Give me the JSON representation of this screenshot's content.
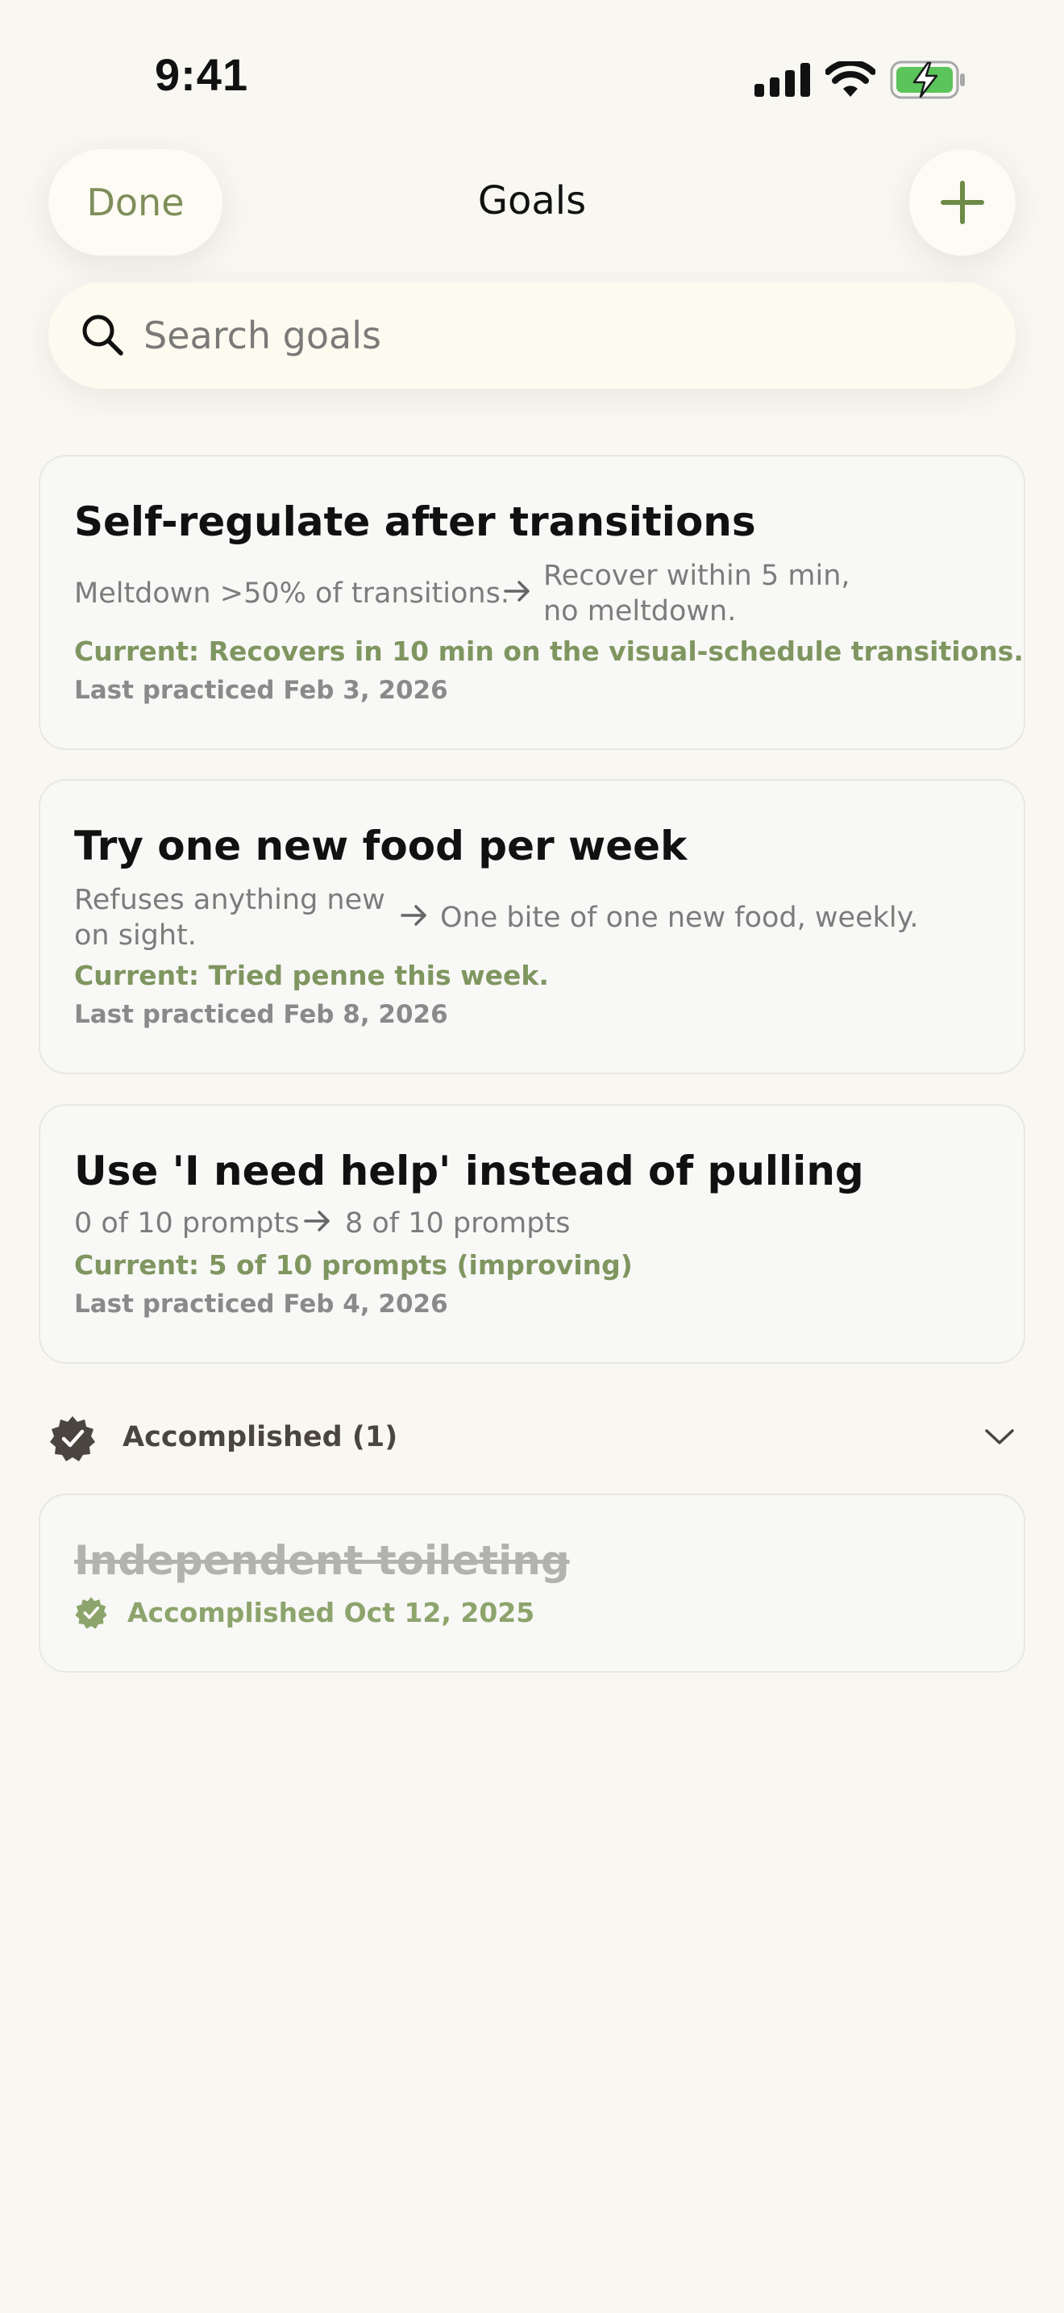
{
  "status_bar": {
    "time": "9:41",
    "icons": [
      "cellular-signal-icon",
      "wifi-icon",
      "battery-charging-icon"
    ]
  },
  "nav": {
    "done_label": "Done",
    "title": "Goals",
    "add_icon": "plus-icon"
  },
  "search": {
    "placeholder": "Search goals",
    "value": "",
    "icon": "search-icon"
  },
  "goals": [
    {
      "title": "Self-regulate after transitions",
      "baseline": "Meltdown >50% of transitions.",
      "target_line1": "Recover within 5 min,",
      "target_line2": "no meltdown.",
      "current": "Current: Recovers in 10 min on the visual-schedule transitions.",
      "last_practiced": "Last practiced Feb 3, 2026"
    },
    {
      "title": "Try one new food per week",
      "baseline_line1": "Refuses anything new",
      "baseline_line2": "on sight.",
      "target": "One bite of one new food, weekly.",
      "current": "Current: Tried penne this week.",
      "last_practiced": "Last practiced Feb 8, 2026"
    },
    {
      "title": "Use 'I need help' instead of pulling",
      "baseline": "0 of 10 prompts",
      "target": "8 of 10 prompts",
      "current": "Current: 5 of 10 prompts (improving)",
      "last_practiced": "Last practiced Feb 4, 2026"
    }
  ],
  "accomplished": {
    "header": "Accomplished (1)",
    "expanded": true,
    "items": [
      {
        "title": "Independent toileting",
        "date": "Accomplished Oct 12, 2025"
      }
    ]
  },
  "colors": {
    "background": "#f9f7f2",
    "accent_green": "#7f9660",
    "done_text": "#7e8e5a",
    "muted_text": "#7c7c7c",
    "battery_green": "#5bc45a"
  }
}
